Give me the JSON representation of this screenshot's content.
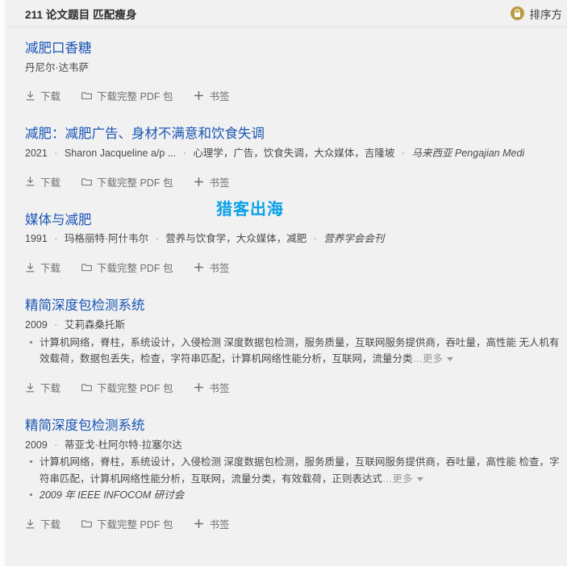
{
  "header": {
    "results_count_label": "211 论文题目 匹配瘦身",
    "sort_label": "排序方",
    "lock_icon": "lock-icon",
    "lock_color": "#b89b3c"
  },
  "theme": {
    "background": "#f1f1f1",
    "title_link_color": "#1a56b5",
    "meta_text_color": "#4a4a4a",
    "action_text_color": "#6e6e6e",
    "watermark_color": "#0aa2e8"
  },
  "watermark": {
    "text": "猎客出海"
  },
  "actions": {
    "download_label": "下载",
    "download_package_label": "下载完整 PDF 包",
    "bookmark_label": "书签",
    "download_icon": "download-icon",
    "folder_icon": "folder-icon",
    "plus_icon": "plus-icon"
  },
  "results": [
    {
      "title": "减肥口香糖",
      "meta": {
        "year": "",
        "authors": "丹尼尔·达韦萨",
        "keywords": "",
        "venue": ""
      },
      "keyword_lines": []
    },
    {
      "title": "减肥：减肥广告、身材不满意和饮食失调",
      "meta": {
        "year": "2021",
        "authors": "Sharon Jacqueline a/p ...",
        "keywords": "心理学，广告，饮食失调，大众媒体，吉隆坡",
        "venue": "马来西亚 Pengajian Medi"
      },
      "keyword_lines": []
    },
    {
      "title": "媒体与减肥",
      "meta": {
        "year": "1991",
        "authors": "玛格丽特·阿什韦尔",
        "keywords": "营养与饮食学，大众媒体，减肥",
        "venue": "营养学会会刊"
      },
      "keyword_lines": []
    },
    {
      "title": "精简深度包检测系统",
      "meta": {
        "year": "2009",
        "authors": "艾莉森桑托斯",
        "keywords": "",
        "venue": ""
      },
      "keyword_lines": [
        {
          "text": "计算机网络，脊柱，系统设计，入侵检测 深度数据包检测，服务质量，互联网服务提供商，吞吐量，高性能 无人机有效载荷，数据包丢失，检查，字符串匹配，计算机网络性能分析，互联网，流量分类",
          "more_label": "…更多",
          "italic": false
        }
      ]
    },
    {
      "title": "精简深度包检测系统",
      "meta": {
        "year": "2009",
        "authors": "蒂亚戈·杜阿尔特·拉塞尔达",
        "keywords": "",
        "venue": ""
      },
      "keyword_lines": [
        {
          "text": "计算机网络，脊柱，系统设计，入侵检测 深度数据包检测，服务质量，互联网服务提供商，吞吐量，高性能 检查，字符串匹配，计算机网络性能分析，互联网，流量分类，有效载荷，正则表达式",
          "more_label": "…更多",
          "italic": false
        },
        {
          "text": "2009 年 IEEE INFOCOM 研讨会",
          "more_label": "",
          "italic": true
        }
      ]
    }
  ]
}
